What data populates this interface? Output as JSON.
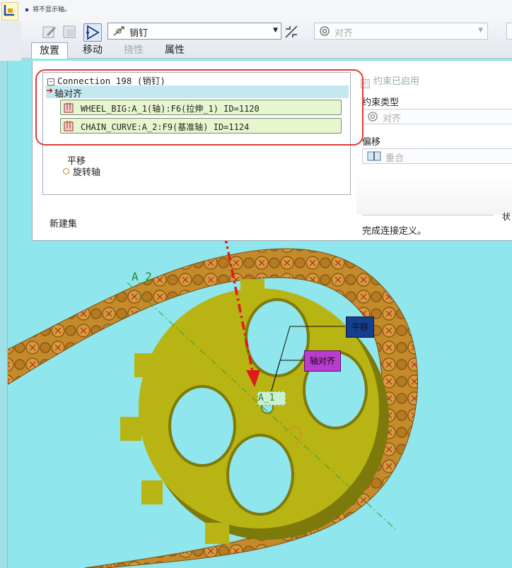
{
  "status_message": "将不显示轴。",
  "toolbar": {
    "connection_type": "销钉",
    "constraint_type": "对齐"
  },
  "tabs": [
    {
      "label": "放置"
    },
    {
      "label": "移动"
    },
    {
      "label": "挠性"
    },
    {
      "label": "属性"
    }
  ],
  "tree": {
    "root": "Connection_198 (销钉)",
    "selected": "轴对齐",
    "refs": [
      "WHEEL_BIG:A_1(轴):F6(拉伸_1) ID=1120",
      "CHAIN_CURVE:A_2:F9(基准轴) ID=1124"
    ],
    "items": [
      "平移",
      "旋转轴"
    ],
    "new_set": "新建集"
  },
  "right": {
    "enabled_label": "约束已启用",
    "constraint_type_label": "约束类型",
    "constraint_type_value": "对齐",
    "offset_label": "偏移",
    "offset_value": "重合",
    "status_label": "状",
    "status_text": "完成连接定义。"
  },
  "scene": {
    "axis_label_a2": "A_2",
    "axis_label_a1": "A_1",
    "callout_translation": "平移",
    "callout_axis_align": "轴对齐"
  },
  "colors": {
    "background": "#8fe6ec",
    "highlight_ring": "#e23a3a",
    "tree_selection": "#c4e8ef",
    "ref_fill": "#e6f7cf",
    "gear": "#b8b413",
    "chain": "#c58a2a",
    "callout_translation": "#153e8e",
    "callout_axis_align": "#b93bd0"
  },
  "icons": [
    "app-assembly-icon",
    "edit-tool-icon",
    "copy-tool-icon",
    "placement-tool-icon",
    "pin-connection-icon",
    "flip-icon",
    "align-icon",
    "coincident-icon"
  ]
}
